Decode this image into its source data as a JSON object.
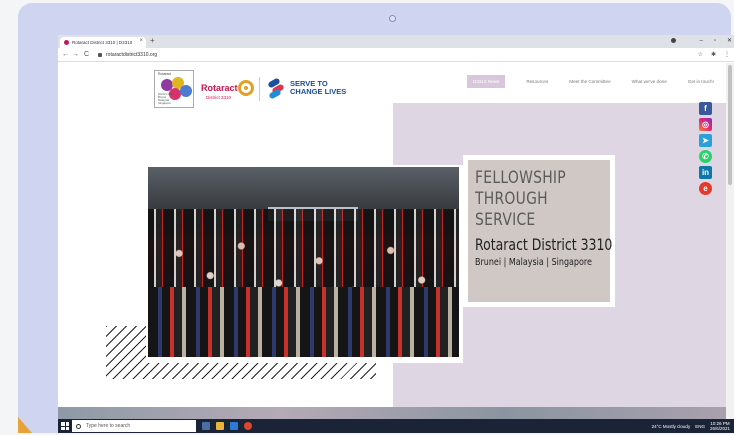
{
  "browser": {
    "tab_title": "Rotaract District 3310 | D3310",
    "tab_close": "×",
    "new_tab": "+",
    "url": "rotaractdistrict3310.org",
    "back": "←",
    "forward": "→",
    "reload": "C",
    "star": "☆",
    "extensions": "✱",
    "menu": "⋮",
    "win_min": "–",
    "win_max": "▫",
    "win_close": "✕"
  },
  "header": {
    "ribbon_label": "Rotaract",
    "ribbon_small": "District 3310 Brunei Malaysia Singapore",
    "rotaract_text": "Rotaract",
    "district_text": "District 3310",
    "serve_line1": "SERVE TO",
    "serve_line2": "CHANGE LIVES"
  },
  "nav": {
    "items": [
      {
        "label": "D3310 News",
        "active": true
      },
      {
        "label": "Resources",
        "active": false
      },
      {
        "label": "Meet the Committee",
        "active": false
      },
      {
        "label": "What we've done",
        "active": false
      },
      {
        "label": "Get in touch!",
        "active": false
      }
    ]
  },
  "social": {
    "facebook": "f",
    "instagram": "◎",
    "telegram": "➤",
    "whatsapp": "✆",
    "linkedin": "in",
    "eventbrite": "e"
  },
  "hero": {
    "headline_line1": "FELLOWSHIP",
    "headline_line2": "THROUGH",
    "headline_line3": "SERVICE",
    "district_title": "Rotaract District 3310",
    "countries": "Brunei | Malaysia | Singapore"
  },
  "taskbar": {
    "search_placeholder": "Type here to search",
    "weather": "24°C  Mostly cloudy",
    "lang": "ENG",
    "time": "10:26 PM",
    "date": "26/6/2021"
  },
  "colors": {
    "brand_magenta": "#c8174e",
    "lavender": "#ded7e3",
    "nav_active": "#d8c7dc",
    "serve_blue": "#1c4fa0"
  }
}
